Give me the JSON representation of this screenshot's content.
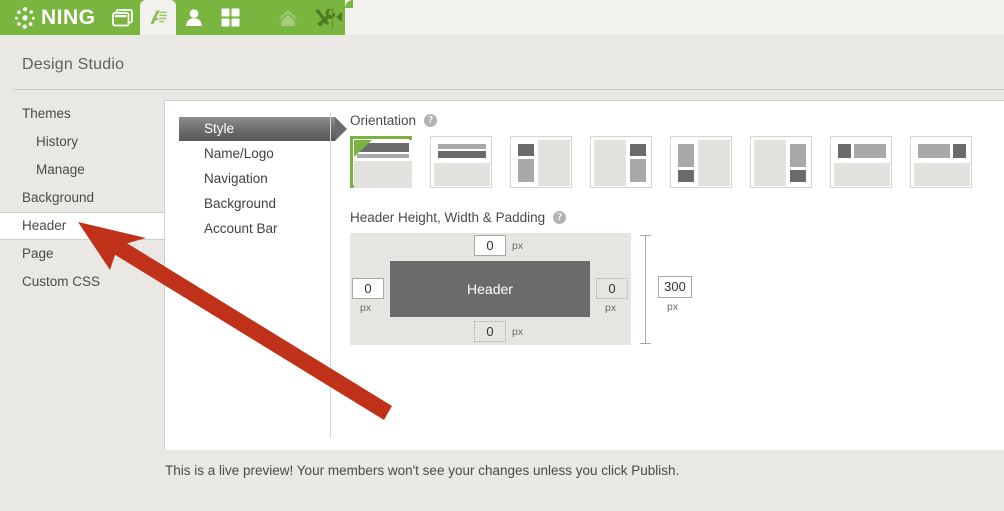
{
  "topbar": {
    "brand": "NING",
    "brand_icon": "ning-dots-logo",
    "accent_color": "#7ab540",
    "nav_items": [
      {
        "name": "browser-window-icon",
        "label": "My Network",
        "active": false
      },
      {
        "name": "design-studio-icon",
        "label": "Design Studio",
        "active": true
      },
      {
        "name": "person-icon",
        "label": "Members",
        "active": false
      },
      {
        "name": "grid-icon",
        "label": "Apps",
        "active": false
      },
      {
        "name": "home-icon",
        "label": "Home",
        "active": false
      },
      {
        "name": "tools-icon",
        "label": "Tools",
        "active": false
      }
    ],
    "collapse_label": "Collapse"
  },
  "page": {
    "title": "Design Studio"
  },
  "sidebar": {
    "items": [
      {
        "label": "Themes",
        "sub": false,
        "selected": false
      },
      {
        "label": "History",
        "sub": true,
        "selected": false
      },
      {
        "label": "Manage",
        "sub": true,
        "selected": false
      },
      {
        "label": "Background",
        "sub": false,
        "selected": false
      },
      {
        "label": "Header",
        "sub": false,
        "selected": true
      },
      {
        "label": "Page",
        "sub": false,
        "selected": false
      },
      {
        "label": "Custom CSS",
        "sub": false,
        "selected": false
      }
    ]
  },
  "subnav": {
    "items": [
      {
        "label": "Style",
        "active": true
      },
      {
        "label": "Name/Logo",
        "active": false
      },
      {
        "label": "Navigation",
        "active": false
      },
      {
        "label": "Background",
        "active": false
      },
      {
        "label": "Account Bar",
        "active": false
      }
    ]
  },
  "orientation": {
    "label": "Orientation",
    "help_icon": "question-mark-icon",
    "selected_index": 0,
    "options": [
      {
        "name": "orientation-stacked-top-full"
      },
      {
        "name": "orientation-stacked-top-inset"
      },
      {
        "name": "orientation-left-column-top"
      },
      {
        "name": "orientation-right-column-top"
      },
      {
        "name": "orientation-left-column-bottom"
      },
      {
        "name": "orientation-right-column-bottom"
      },
      {
        "name": "orientation-banner-left-logo"
      },
      {
        "name": "orientation-banner-right-logo"
      }
    ]
  },
  "sizing": {
    "label": "Header Height, Width & Padding",
    "help_icon": "question-mark-icon",
    "header_box_label": "Header",
    "padding_top": "0",
    "padding_right": "0",
    "padding_bottom": "0",
    "padding_left": "0",
    "height_value": "300",
    "unit": "px"
  },
  "footer": {
    "note": "This is a live preview! Your members won't see your changes unless you click Publish."
  },
  "annotation": {
    "arrow_name": "red-pointer-arrow",
    "arrow_color": "#c0311a",
    "points_to": "sidebar-item-header"
  }
}
